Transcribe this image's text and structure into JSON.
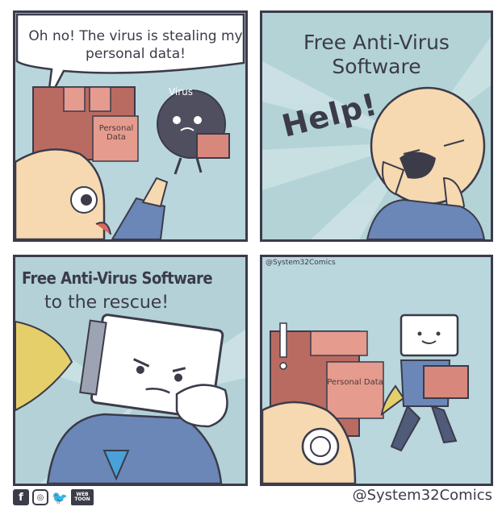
{
  "panel1": {
    "speech": "Oh no! The virus is stealing my personal data!",
    "virus_label": "Virus",
    "box_label": "Personal Data"
  },
  "panel2": {
    "caption": "Free Anti-Virus Software",
    "help": "Help!"
  },
  "panel3": {
    "caption_title": "Free Anti-Virus Software",
    "caption_sub": "to the rescue!"
  },
  "panel4": {
    "credit": "@System32Comics",
    "box_label": "Personal Data"
  },
  "footer": {
    "credit": "@System32Comics",
    "social_icons": [
      "facebook-icon",
      "instagram-icon",
      "twitter-icon",
      "webtoon-icon"
    ],
    "webtoon_text": "WEB TOON"
  },
  "colors": {
    "border": "#3b3b4a",
    "sky": "#b9d6dc",
    "skin": "#f6d9b0",
    "box": "#d8877c",
    "virus": "#4f4f60",
    "hero_suit": "#6a87b8",
    "cape": "#e5cf6a"
  }
}
